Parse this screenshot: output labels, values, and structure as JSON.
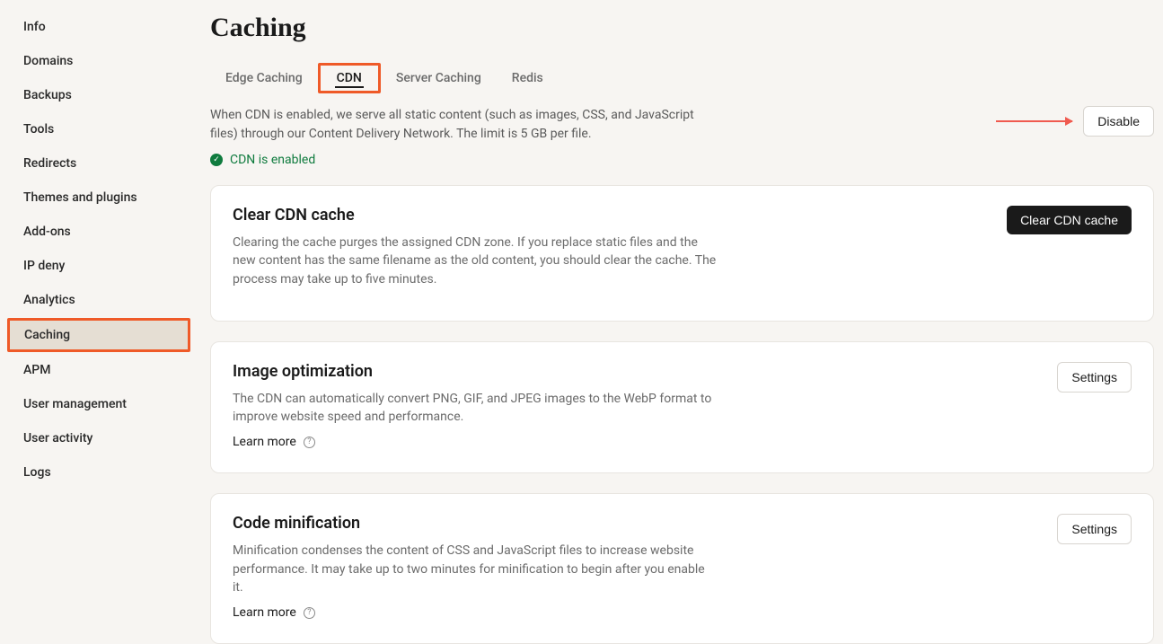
{
  "sidebar": {
    "items": [
      {
        "label": "Info",
        "active": false
      },
      {
        "label": "Domains",
        "active": false
      },
      {
        "label": "Backups",
        "active": false
      },
      {
        "label": "Tools",
        "active": false
      },
      {
        "label": "Redirects",
        "active": false
      },
      {
        "label": "Themes and plugins",
        "active": false
      },
      {
        "label": "Add-ons",
        "active": false
      },
      {
        "label": "IP deny",
        "active": false
      },
      {
        "label": "Analytics",
        "active": false
      },
      {
        "label": "Caching",
        "active": true
      },
      {
        "label": "APM",
        "active": false
      },
      {
        "label": "User management",
        "active": false
      },
      {
        "label": "User activity",
        "active": false
      },
      {
        "label": "Logs",
        "active": false
      }
    ]
  },
  "page": {
    "title": "Caching"
  },
  "tabs": [
    {
      "label": "Edge Caching",
      "active": false
    },
    {
      "label": "CDN",
      "active": true
    },
    {
      "label": "Server Caching",
      "active": false
    },
    {
      "label": "Redis",
      "active": false
    }
  ],
  "intro": {
    "description": "When CDN is enabled, we serve all static content (such as images, CSS, and JavaScript files) through our Content Delivery Network. The limit is 5 GB per file.",
    "status_text": "CDN is enabled",
    "disable_button": "Disable"
  },
  "cards": {
    "clear_cache": {
      "title": "Clear CDN cache",
      "description": "Clearing the cache purges the assigned CDN zone. If you replace static files and the new content has the same filename as the old content, you should clear the cache. The process may take up to five minutes.",
      "button": "Clear CDN cache"
    },
    "image_optimization": {
      "title": "Image optimization",
      "description": "The CDN can automatically convert PNG, GIF, and JPEG images to the WebP format to improve website speed and performance.",
      "learn_more": "Learn more",
      "button": "Settings"
    },
    "code_minification": {
      "title": "Code minification",
      "description": "Minification condenses the content of CSS and JavaScript files to increase website performance. It may take up to two minutes for minification to begin after you enable it.",
      "learn_more": "Learn more",
      "button": "Settings"
    }
  }
}
